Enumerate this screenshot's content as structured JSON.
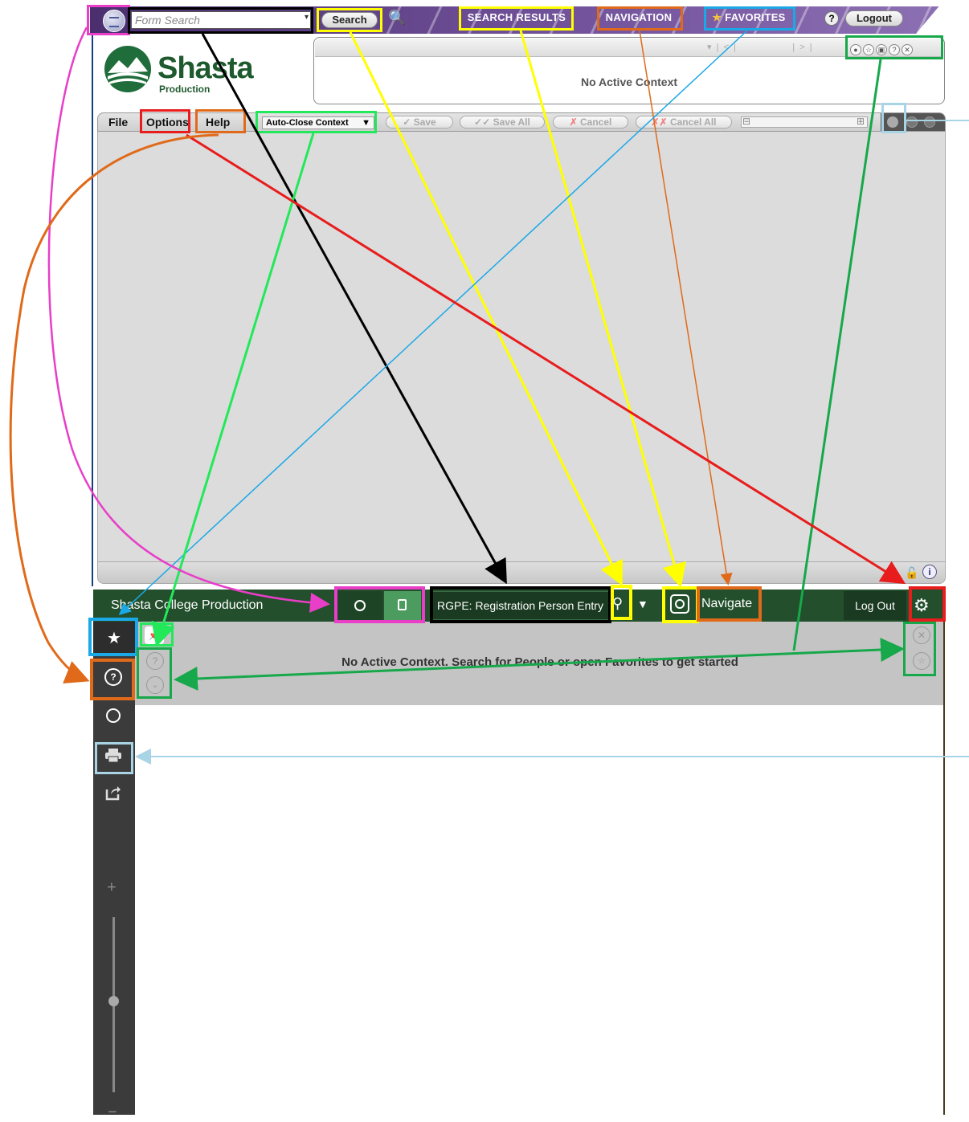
{
  "old_ui": {
    "form_search_placeholder": "Form Search",
    "search_label": "Search",
    "tabs": [
      "SEARCH RESULTS",
      "NAVIGATION",
      "FAVORITES"
    ],
    "help_label": "?",
    "logout_label": "Logout",
    "logo_title": "Shasta",
    "logo_subtitle": "Production",
    "context_text": "No Active Context",
    "menus": [
      "File",
      "Options",
      "Help"
    ],
    "auto_close_label": "Auto-Close Context",
    "toolbar_buttons": [
      "Save",
      "Save All",
      "Cancel",
      "Cancel All"
    ]
  },
  "new_ui": {
    "title": "Shasta College Production",
    "search_value": "RGPE: Registration Person Entry",
    "navigate_label": "Navigate",
    "logout_label": "Log Out",
    "context_text": "No Active Context. Search for People or open Favorites to get started"
  },
  "annotation_colors": {
    "magenta": "#e83ec8",
    "black": "#000000",
    "yellow": "#ffff00",
    "orange": "#e06a1a",
    "blue": "#1aa8e6",
    "green": "#16a84a",
    "lightgreen": "#22e85a",
    "red": "#e81c1c",
    "lightblue": "#a8d4e6"
  },
  "icons": {
    "old_app": "hamburger-circle-icon",
    "old_magnify": "magnify-plus-icon",
    "new_person": "person-circle-icon",
    "new_form": "document-icon",
    "new_search": "search-icon",
    "new_history": "history-icon",
    "new_settings": "gear-icon",
    "sidebar_favorites": "star-icon",
    "sidebar_help": "question-circle-icon",
    "sidebar_person": "person-circle-icon",
    "sidebar_print": "printer-icon",
    "sidebar_share": "share-icon"
  }
}
